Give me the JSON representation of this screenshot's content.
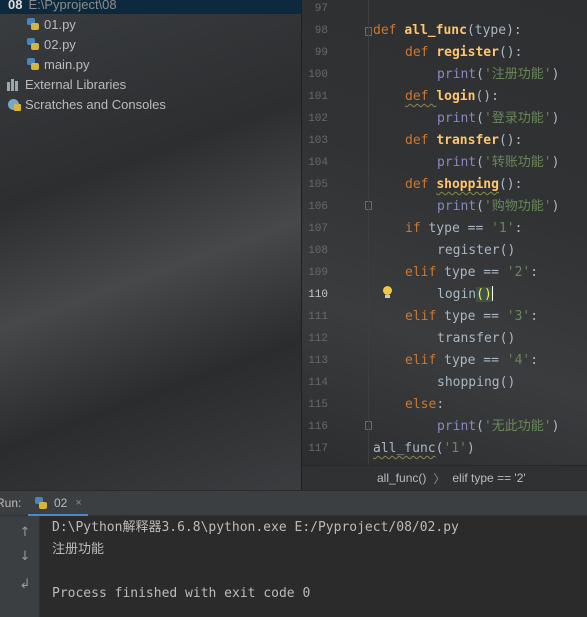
{
  "project_tree": {
    "root_name": "08",
    "root_path": "E:\\Pyproject\\08",
    "files": [
      "01.py",
      "02.py",
      "main.py"
    ],
    "external_libraries": "External Libraries",
    "scratches": "Scratches and Consoles"
  },
  "editor": {
    "line_numbers": [
      "97",
      "98",
      "99",
      "100",
      "101",
      "102",
      "103",
      "104",
      "105",
      "106",
      "107",
      "108",
      "109",
      "110",
      "111",
      "112",
      "113",
      "114",
      "115",
      "116",
      "117"
    ],
    "current_line": "110",
    "lines": {
      "l98_def": "def ",
      "l98_name": "all_func",
      "l98_open": "(",
      "l98_param": "type",
      "l98_close": "):",
      "l99_def": "def ",
      "l99_name": "register",
      "l99_rest": "():",
      "l100_print": "print",
      "l100_open": "(",
      "l100_str": "'注册功能'",
      "l100_close": ")",
      "l101_def": "def ",
      "l101_name": "login",
      "l101_rest": "():",
      "l102_print": "print",
      "l102_open": "(",
      "l102_str": "'登录功能'",
      "l102_close": ")",
      "l103_def": "def ",
      "l103_name": "transfer",
      "l103_rest": "():",
      "l104_print": "print",
      "l104_open": "(",
      "l104_str": "'转账功能'",
      "l104_close": ")",
      "l105_def": "def ",
      "l105_name": "shopping",
      "l105_rest": "():",
      "l106_print": "print",
      "l106_open": "(",
      "l106_str": "'购物功能'",
      "l106_close": ")",
      "l107_kw": "if ",
      "l107_rest": "type == ",
      "l107_str": "'1'",
      "l107_end": ":",
      "l108": "register()",
      "l109_kw": "elif ",
      "l109_rest": "type == ",
      "l109_str": "'2'",
      "l109_end": ":",
      "l110_name": "login",
      "l110_parens": "()",
      "l111_kw": "elif ",
      "l111_rest": "type == ",
      "l111_str": "'3'",
      "l111_end": ":",
      "l112": "transfer()",
      "l113_kw": "elif ",
      "l113_rest": "type == ",
      "l113_str": "'4'",
      "l113_end": ":",
      "l114": "shopping()",
      "l115_kw": "else",
      "l115_end": ":",
      "l116_print": "print",
      "l116_open": "(",
      "l116_str": "'无此功能'",
      "l116_close": ")",
      "l117_call": "all_func",
      "l117_open": "(",
      "l117_str": "'1'",
      "l117_close": ")"
    }
  },
  "breadcrumb": {
    "items": [
      "all_func()",
      "elif type == '2'"
    ],
    "separator": "〉"
  },
  "run_panel": {
    "label": "Run:",
    "tab_label": "02",
    "tab_close": "×",
    "output": [
      "D:\\Python解释器3.6.8\\python.exe E:/Pyproject/08/02.py",
      "注册功能",
      "",
      "Process finished with exit code 0"
    ],
    "side_icons": [
      "up-arrow-icon",
      "down-arrow-icon",
      "soft-wrap-icon"
    ]
  },
  "colors": {
    "keyword": "#cc7832",
    "function": "#ffc66d",
    "string": "#6a8759",
    "builtin": "#8888c6",
    "accent": "#4a88c7"
  }
}
